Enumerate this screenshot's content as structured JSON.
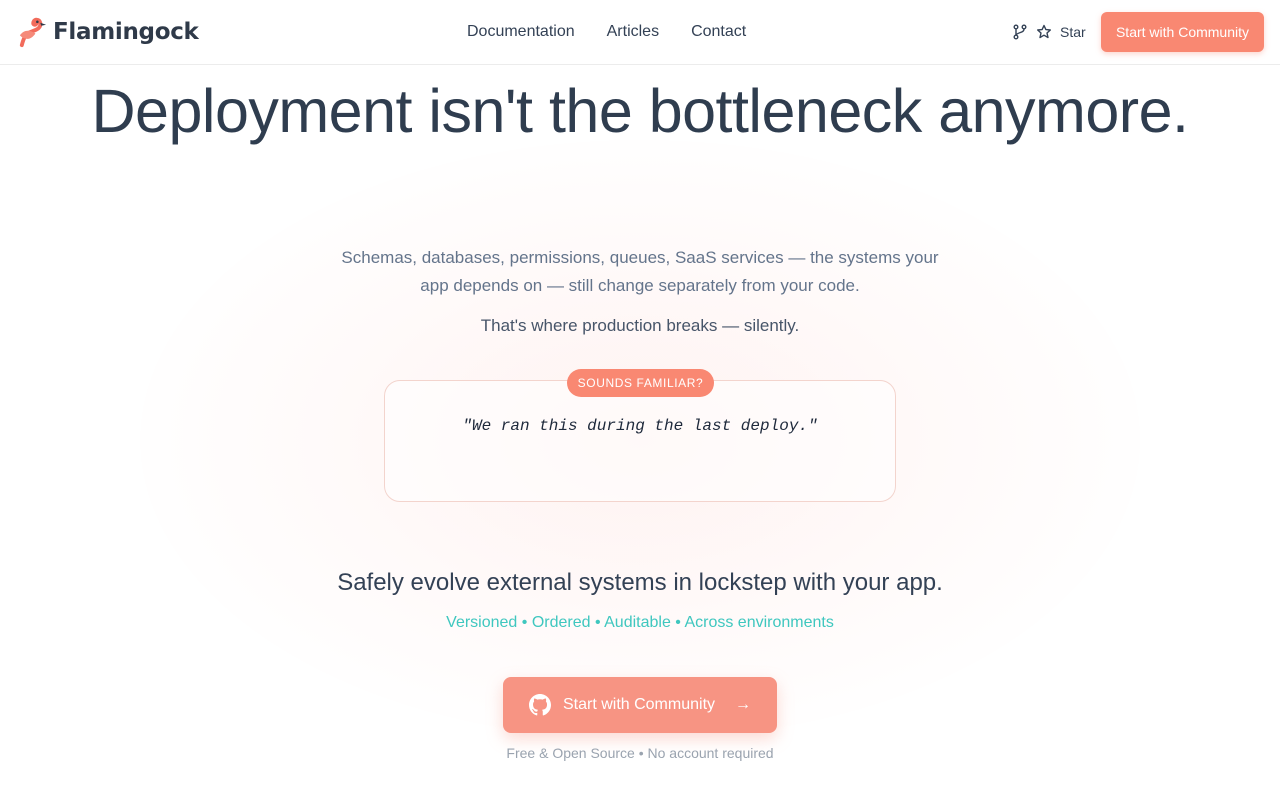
{
  "header": {
    "brand": "Flamingock",
    "nav": [
      "Documentation",
      "Articles",
      "Contact"
    ],
    "star_label": "Star",
    "cta_label": "Start with Community"
  },
  "hero": {
    "title": "Deployment isn't the bottleneck anymore.",
    "lead": "Schemas, databases, permissions, queues, SaaS services — the systems your app depends on — still change separately from your code.",
    "lead2": "That's where production breaks — silently.",
    "badge": "SOUNDS FAMILIAR?",
    "quote": "\"We ran this during the last deploy.\"",
    "tagline": "Safely evolve external systems in lockstep with your app.",
    "features": "Versioned • Ordered • Auditable • Across environments",
    "cta_label": "Start with Community",
    "cta_arrow": "→",
    "footnote": "Free & Open Source • No account required"
  },
  "colors": {
    "accent": "#f98872",
    "teal": "#3fc7bf",
    "heading": "#2f3d4f"
  },
  "icons": [
    "flamingo-logo-icon",
    "git-branch-icon",
    "star-icon",
    "github-icon",
    "arrow-right-icon"
  ]
}
